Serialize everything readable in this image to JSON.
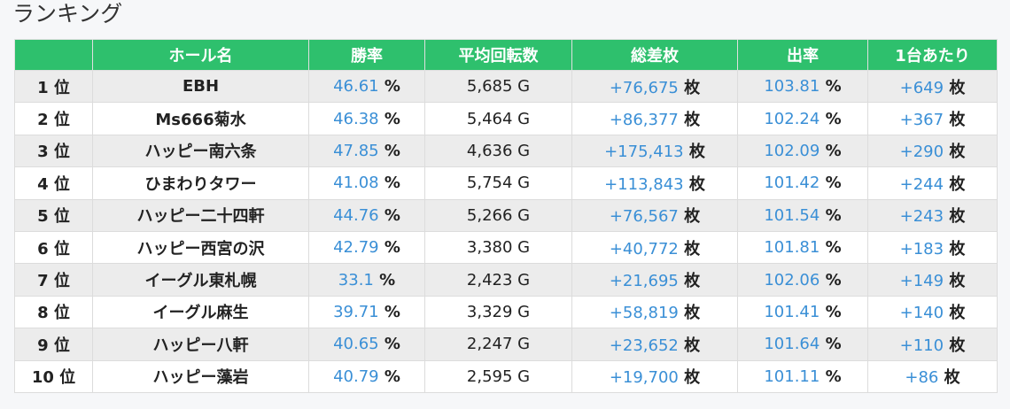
{
  "title": "ランキング",
  "columns": [
    "",
    "ホール名",
    "勝率",
    "平均回転数",
    "総差枚",
    "出率",
    "1台あたり"
  ],
  "rows": [
    {
      "rank": "1 位",
      "hall": "EBH",
      "win_rate": "46.61",
      "avg_spins": "5,685 G",
      "total_diff": "+76,675",
      "payout": "103.81",
      "per_unit": "+649"
    },
    {
      "rank": "2 位",
      "hall": "Ms666菊水",
      "win_rate": "46.38",
      "avg_spins": "5,464 G",
      "total_diff": "+86,377",
      "payout": "102.24",
      "per_unit": "+367"
    },
    {
      "rank": "3 位",
      "hall": "ハッピー南六条",
      "win_rate": "47.85",
      "avg_spins": "4,636 G",
      "total_diff": "+175,413",
      "payout": "102.09",
      "per_unit": "+290"
    },
    {
      "rank": "4 位",
      "hall": "ひまわりタワー",
      "win_rate": "41.08",
      "avg_spins": "5,754 G",
      "total_diff": "+113,843",
      "payout": "101.42",
      "per_unit": "+244"
    },
    {
      "rank": "5 位",
      "hall": "ハッピー二十四軒",
      "win_rate": "44.76",
      "avg_spins": "5,266 G",
      "total_diff": "+76,567",
      "payout": "101.54",
      "per_unit": "+243"
    },
    {
      "rank": "6 位",
      "hall": "ハッピー西宮の沢",
      "win_rate": "42.79",
      "avg_spins": "3,380 G",
      "total_diff": "+40,772",
      "payout": "101.81",
      "per_unit": "+183"
    },
    {
      "rank": "7 位",
      "hall": "イーグル東札幌",
      "win_rate": "33.1",
      "avg_spins": "2,423 G",
      "total_diff": "+21,695",
      "payout": "102.06",
      "per_unit": "+149"
    },
    {
      "rank": "8 位",
      "hall": "イーグル麻生",
      "win_rate": "39.71",
      "avg_spins": "3,329 G",
      "total_diff": "+58,819",
      "payout": "101.41",
      "per_unit": "+140"
    },
    {
      "rank": "9 位",
      "hall": "ハッピー八軒",
      "win_rate": "40.65",
      "avg_spins": "2,247 G",
      "total_diff": "+23,652",
      "payout": "101.64",
      "per_unit": "+110"
    },
    {
      "rank": "10 位",
      "hall": "ハッピー藻岩",
      "win_rate": "40.79",
      "avg_spins": "2,595 G",
      "total_diff": "+19,700",
      "payout": "101.11",
      "per_unit": "+86"
    }
  ],
  "units": {
    "percent": "%",
    "mai": "枚"
  },
  "colors": {
    "header_bg": "#2ec06d",
    "number_blue": "#3a8fd6",
    "odd_row": "#ececec",
    "even_row": "#ffffff"
  }
}
